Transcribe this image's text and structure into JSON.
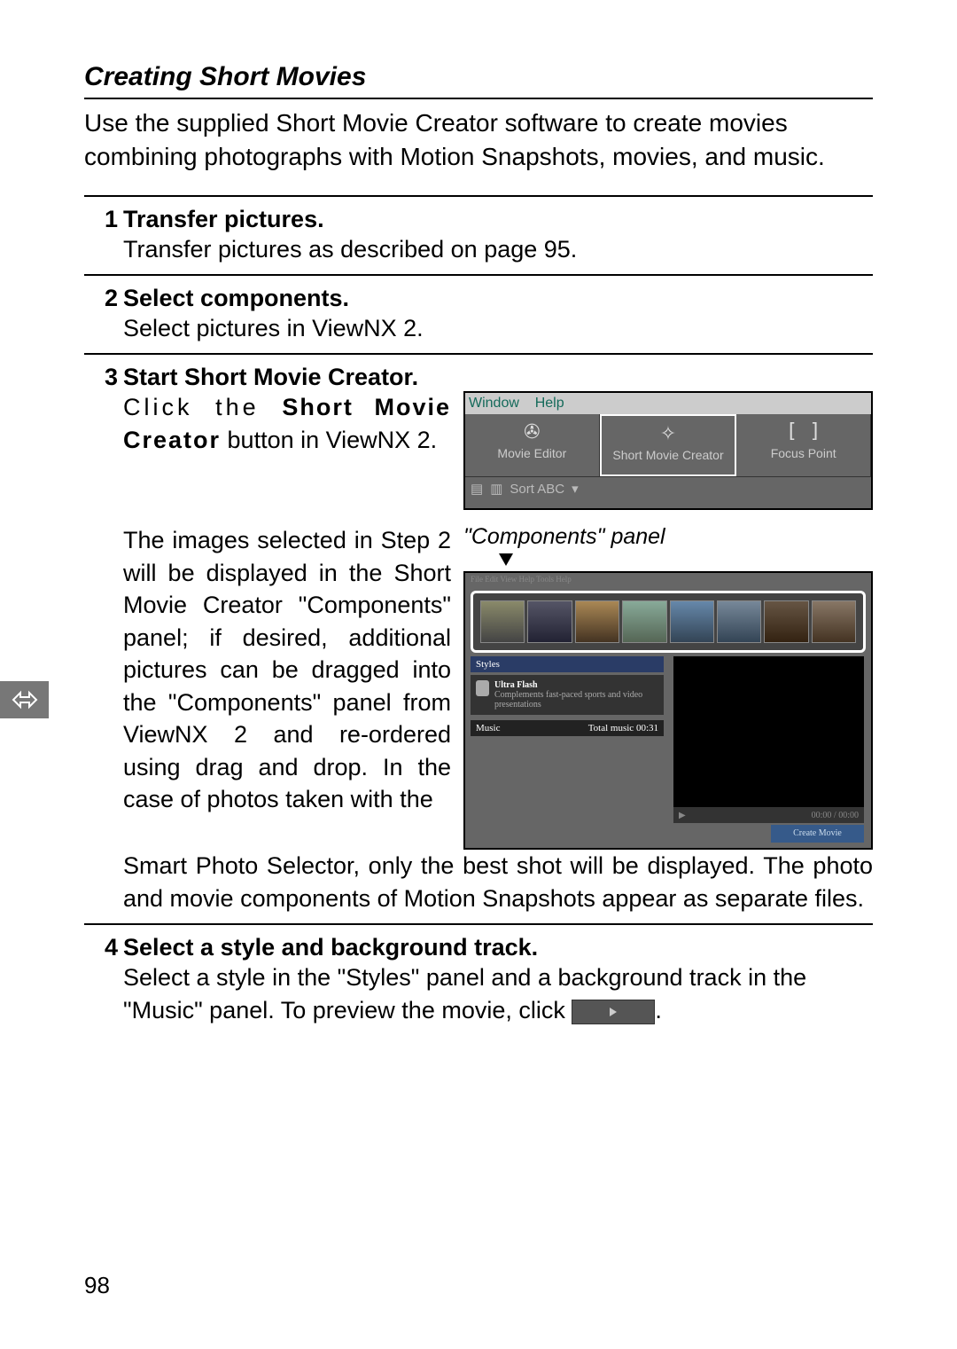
{
  "section_title": "Creating Short Movies",
  "intro": "Use the supplied Short Movie Creator software to create movies combining photographs with Motion Snapshots, movies, and music.",
  "steps": {
    "s1": {
      "num": "1",
      "title": "Transfer pictures.",
      "body": "Transfer pictures as described on page 95."
    },
    "s2": {
      "num": "2",
      "title": "Select components.",
      "body": "Select pictures in ViewNX 2."
    },
    "s3": {
      "num": "3",
      "title": "Start Short Movie Creator.",
      "body_a_prefix": "Click the ",
      "body_a_bold": "Short Movie Creator",
      "body_a_suffix": " button in ViewNX 2.",
      "body_b": "The images selected in Step 2 will be displayed in the Short Movie Creator \"Components\" panel; if desired, additional pictures can be dragged into the \"Components\" panel from ViewNX 2 and re-ordered using drag and drop. In the case of photos taken with the",
      "body_c": "Smart Photo Selector, only the best shot will be displayed. The photo and movie components of Motion Snapshots appear as separate files."
    },
    "s4": {
      "num": "4",
      "title": "Select a style and background track.",
      "body_prefix": "Select a style in the \"Styles\" panel and a background track in the \"Music\" panel. To preview the movie, click ",
      "body_suffix": "."
    }
  },
  "toolbar": {
    "menu_window": "Window",
    "menu_help": "Help",
    "btn1": "Movie Editor",
    "btn2": "Short Movie Creator",
    "btn3": "Focus Point",
    "sort": "Sort ABC"
  },
  "panel_caption": "\"Components\" panel",
  "panel": {
    "styles_label": "Styles",
    "style_name": "Ultra Flash",
    "style_desc": "Complements fast-paced sports and video presentations",
    "music_label": "Music",
    "music_info": "Total music  00:31",
    "timecode": "00:00 / 00:00",
    "create_btn": "Create Movie"
  },
  "page_number": "98"
}
